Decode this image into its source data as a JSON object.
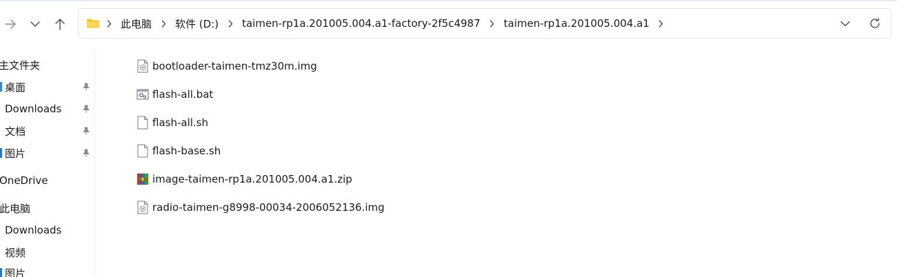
{
  "address_bar": {
    "breadcrumbs": [
      "此电脑",
      "软件 (D:)",
      "taimen-rp1a.201005.004.a1-factory-2f5c4987",
      "taimen-rp1a.201005.004.a1"
    ]
  },
  "sidebar": {
    "items": [
      {
        "label": "主文件夹",
        "pinned": false
      },
      {
        "label": "桌面",
        "pinned": true
      },
      {
        "label": "Downloads",
        "pinned": true
      },
      {
        "label": "文档",
        "pinned": true
      },
      {
        "label": "图片",
        "pinned": true
      },
      {
        "label": "OneDrive",
        "pinned": false
      },
      {
        "label": "此电脑",
        "pinned": false
      },
      {
        "label": "Downloads",
        "pinned": false
      },
      {
        "label": "视频",
        "pinned": false
      },
      {
        "label": "图片",
        "pinned": false
      }
    ]
  },
  "files": [
    {
      "name": "bootloader-taimen-tmz30m.img",
      "icon": "disk-image-icon"
    },
    {
      "name": "flash-all.bat",
      "icon": "batch-file-icon"
    },
    {
      "name": "flash-all.sh",
      "icon": "blank-file-icon"
    },
    {
      "name": "flash-base.sh",
      "icon": "blank-file-icon"
    },
    {
      "name": "image-taimen-rp1a.201005.004.a1.zip",
      "icon": "winrar-archive-icon"
    },
    {
      "name": "radio-taimen-g8998-00034-2006052136.img",
      "icon": "disk-image-icon"
    }
  ],
  "colors": {
    "folder": "#f4c430",
    "text": "#1a1a1a",
    "icon_gray": "#5f6368",
    "border": "#e5e5e5"
  }
}
